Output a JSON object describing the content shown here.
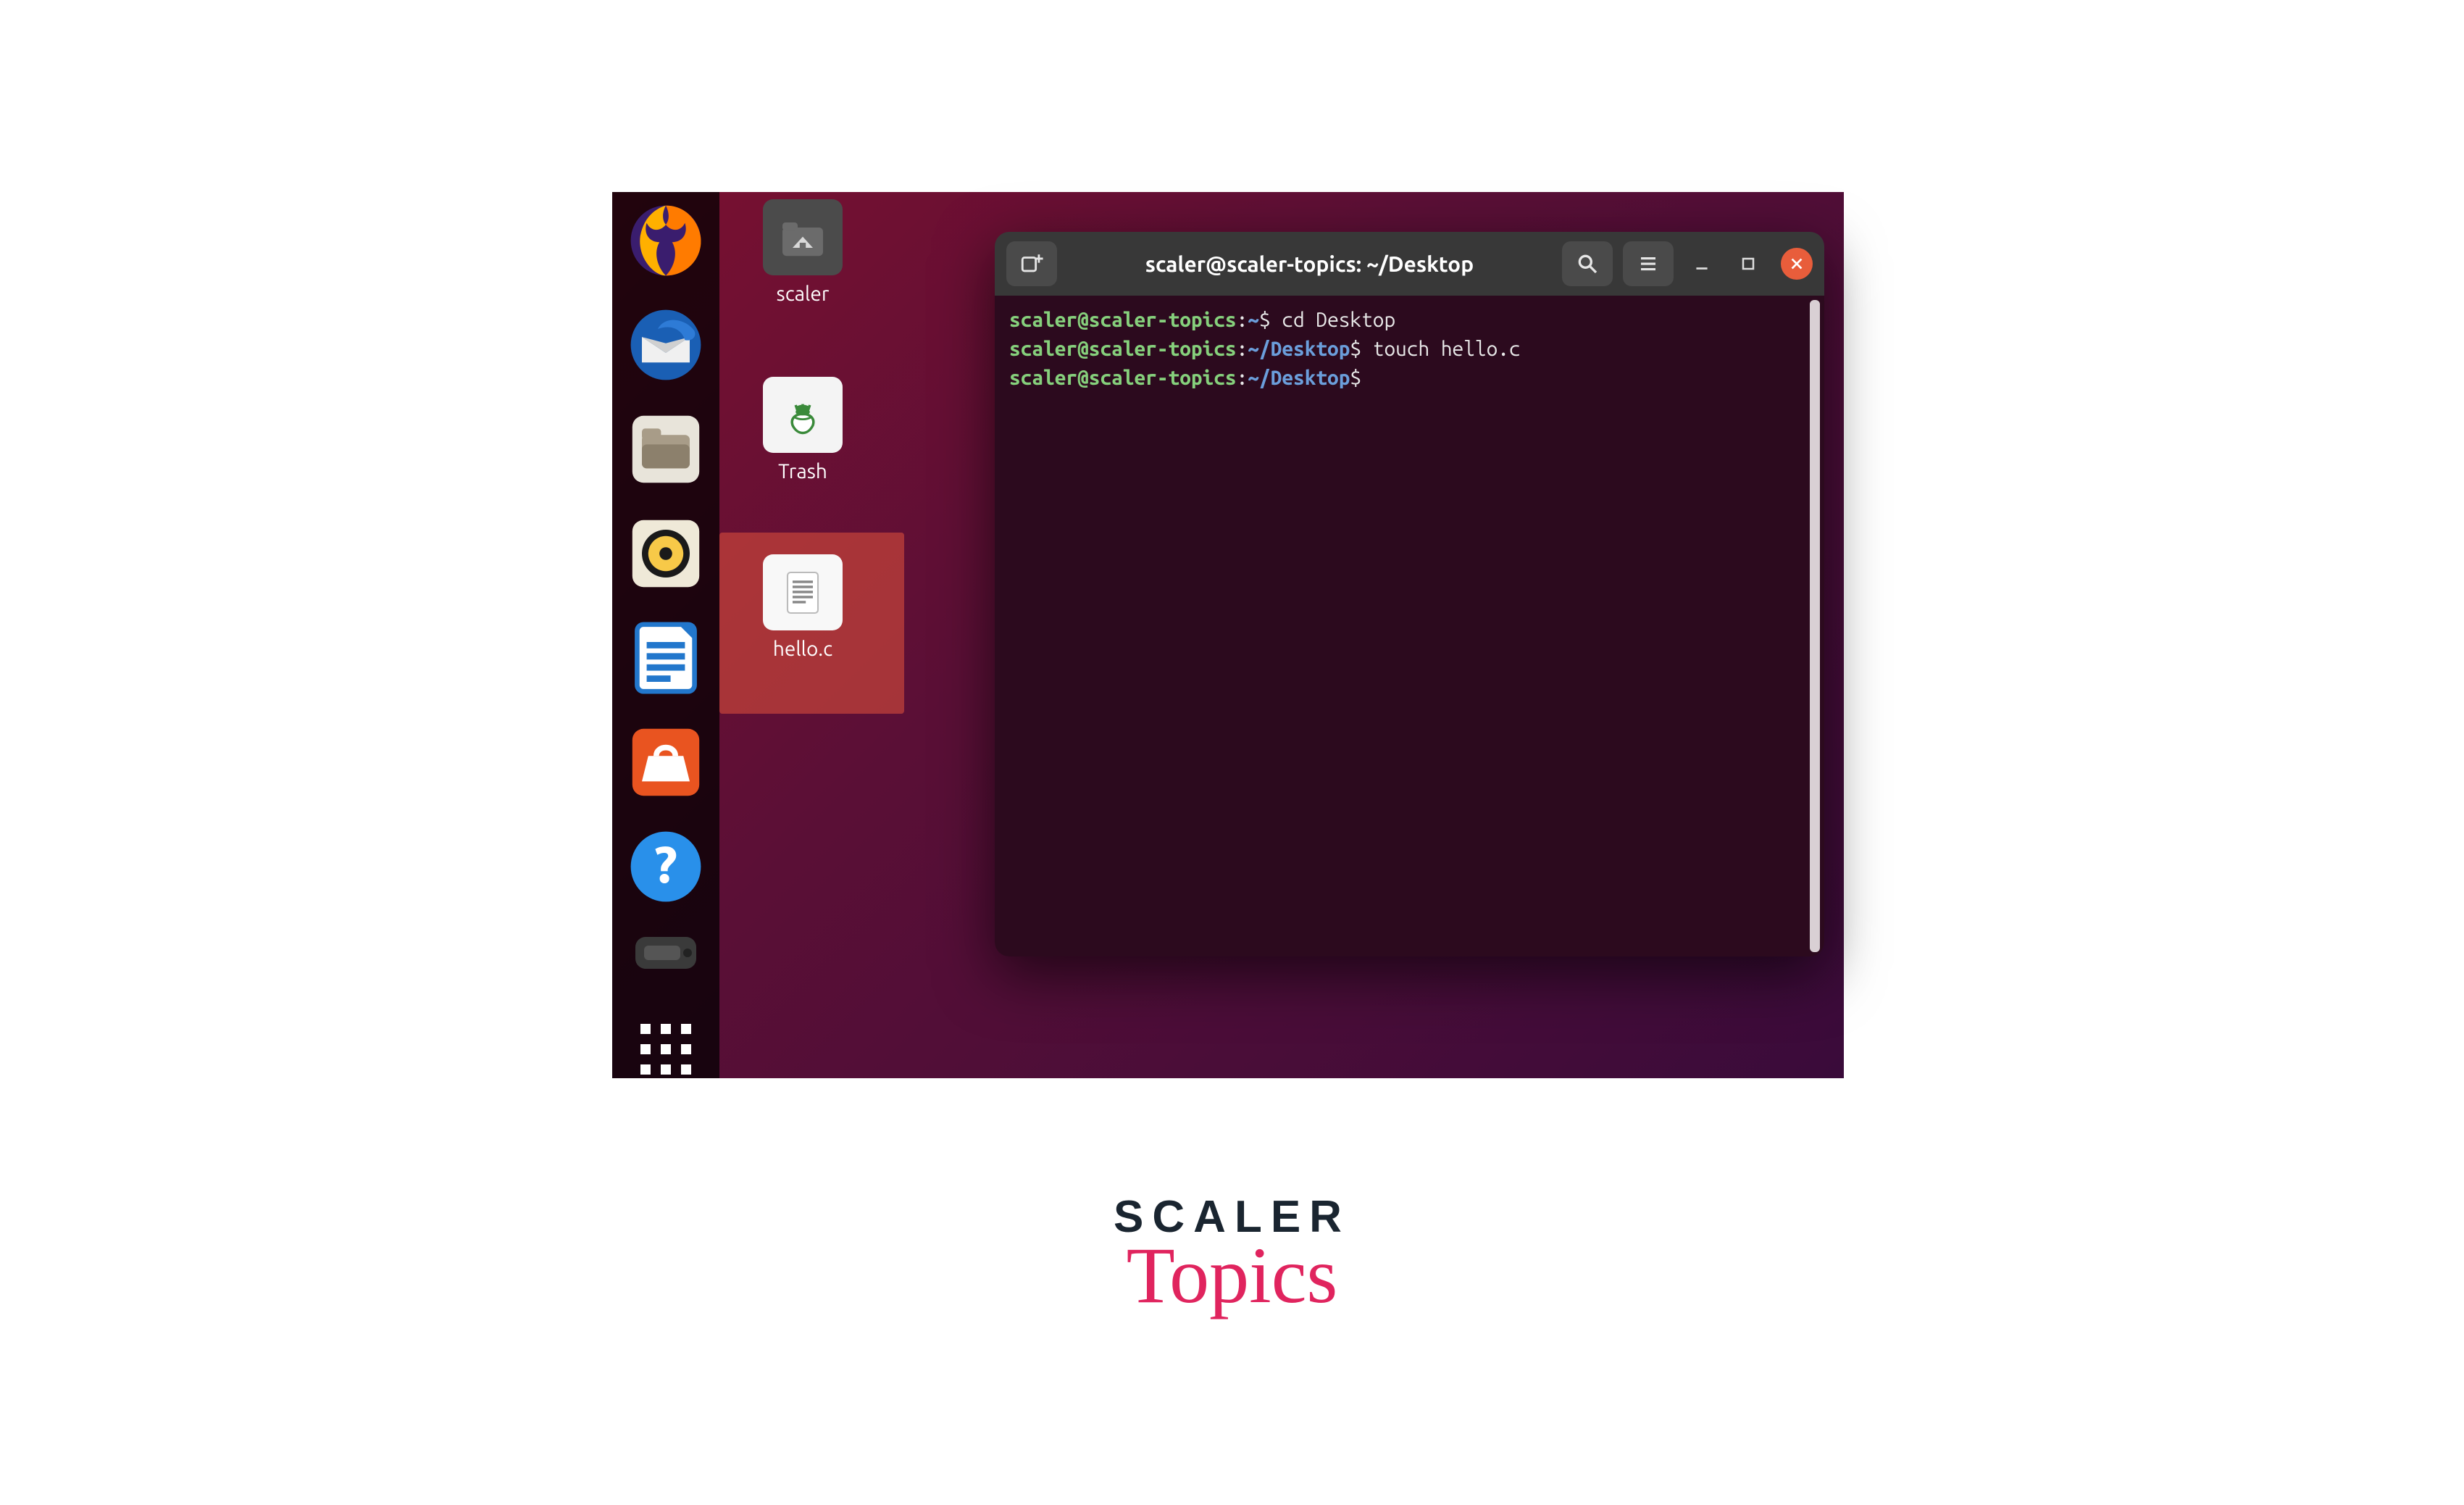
{
  "dock": {
    "items": [
      {
        "name": "firefox"
      },
      {
        "name": "thunderbird"
      },
      {
        "name": "files"
      },
      {
        "name": "rhythmbox"
      },
      {
        "name": "libreoffice-writer"
      },
      {
        "name": "ubuntu-software"
      },
      {
        "name": "help"
      },
      {
        "name": "removable-device"
      }
    ],
    "apps_button": "Show Applications"
  },
  "desktop_icons": {
    "home": {
      "label": "scaler"
    },
    "trash": {
      "label": "Trash"
    },
    "file": {
      "label": "hello.c",
      "selected": true
    }
  },
  "terminal": {
    "title": "scaler@scaler-topics: ~/Desktop",
    "lines": [
      {
        "user": "scaler@scaler-topics",
        "sep": ":",
        "path": "~",
        "dollar": "$",
        "cmd": " cd Desktop"
      },
      {
        "user": "scaler@scaler-topics",
        "sep": ":",
        "path": "~/Desktop",
        "dollar": "$",
        "cmd": " touch hello.c"
      },
      {
        "user": "scaler@scaler-topics",
        "sep": ":",
        "path": "~/Desktop",
        "dollar": "$",
        "cmd": ""
      }
    ]
  },
  "brand": {
    "top": "SCALER",
    "bot": "Topics"
  },
  "colors": {
    "dock_bg": "rgba(0,0,0,0.72)",
    "terminal_bg": "#2c0a1e",
    "titlebar_bg": "#383838",
    "close_btn": "#e85d3b",
    "prompt_user": "#86d07c",
    "prompt_path": "#6b9edb",
    "desktop_gradient_start": "#7a1030",
    "desktop_gradient_end": "#3a0b3a"
  }
}
